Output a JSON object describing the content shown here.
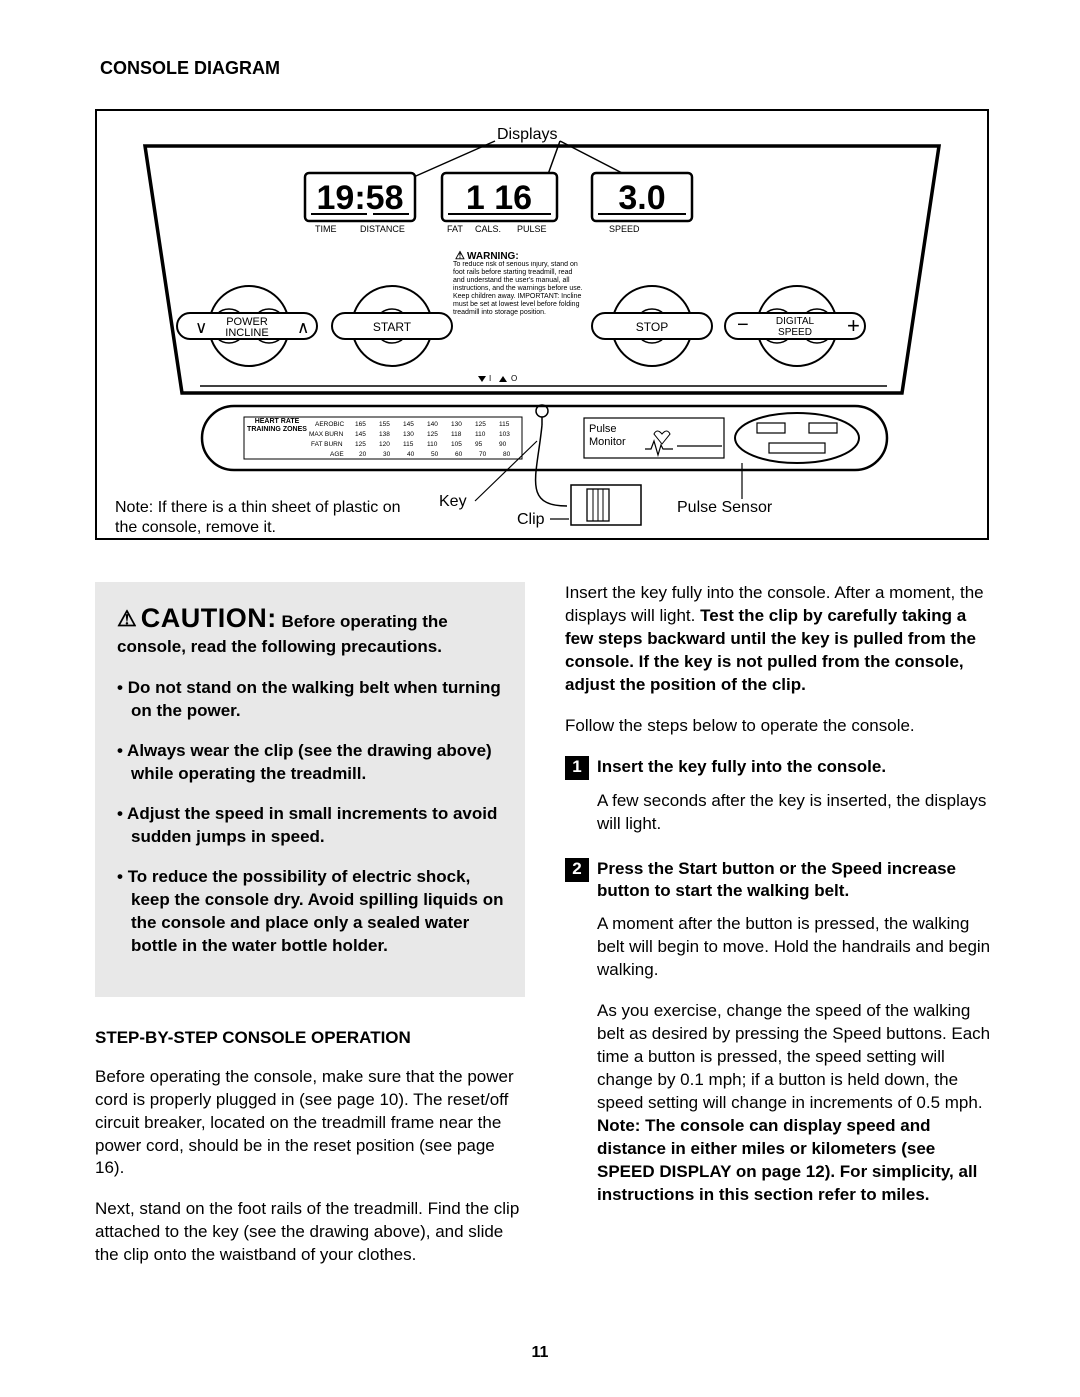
{
  "title": "CONSOLE DIAGRAM",
  "page_number": "11",
  "diagram": {
    "labels": {
      "displays": "Displays",
      "time": "TIME",
      "distance": "DISTANCE",
      "fat": "FAT",
      "cals": "CALS.",
      "pulse": "PULSE",
      "speed_small": "SPEED",
      "warning_head": "WARNING:",
      "warning_text": "To reduce risk of serious injury, stand on foot rails before starting treadmill, read and understand the user's manual, all instructions, and the warnings before use. Keep children away. IMPORTANT: Incline must be set at lowest level before folding treadmill into storage position.",
      "power": "POWER",
      "incline": "INCLINE",
      "start": "START",
      "stop": "STOP",
      "digital": "DIGITAL",
      "speed": "SPEED",
      "note": "Note: If there is a thin sheet of plastic on the console, remove it.",
      "key": "Key",
      "pulse_monitor": "Pulse\nMonitor",
      "clip": "Clip",
      "pulse_sensor": "Pulse Sensor",
      "hrtz_title": "HEART RATE\nTRAINING ZONES",
      "hr_rows": [
        "AEROBIC",
        "MAX BURN",
        "FAT BURN",
        "AGE"
      ],
      "hr_grid": [
        [
          "165",
          "155",
          "145",
          "140",
          "130",
          "125",
          "115"
        ],
        [
          "145",
          "138",
          "130",
          "125",
          "118",
          "110",
          "103"
        ],
        [
          "125",
          "120",
          "115",
          "110",
          "105",
          "95",
          "90"
        ],
        [
          "20",
          "30",
          "40",
          "50",
          "60",
          "70",
          "80"
        ]
      ],
      "disp1": "19:58",
      "disp2": "1 16",
      "disp3": "3.0"
    }
  },
  "caution": {
    "head_big": "CAUTION:",
    "head_tail": "Before operating the console, read the following precautions.",
    "items": [
      "Do not stand on the walking belt when turning on the power.",
      "Always wear the clip (see the drawing above) while operating the treadmill.",
      "Adjust the speed in small increments to avoid sudden jumps in speed.",
      "To reduce the possibility of electric shock, keep the console dry. Avoid spilling liquids on the console and place only a sealed water bottle in the water bottle holder."
    ]
  },
  "step_section_head": "STEP-BY-STEP CONSOLE OPERATION",
  "left_paras": [
    "Before operating the console, make sure that the power cord is properly plugged in (see page 10). The reset/off circuit breaker, located on the treadmill frame near the power cord, should be in the reset position (see page 16).",
    "Next, stand on the foot rails of the treadmill. Find the clip attached to the key (see the drawing above), and slide the clip onto the waistband of your clothes."
  ],
  "right_intro": {
    "pre": "Insert the key fully into the console. After a moment, the displays will light. ",
    "bold": "Test the clip by carefully taking a few steps backward until the key is pulled from the console. If the key is not pulled from the console, adjust the position of the clip.",
    "follow": "Follow the steps below to operate the console."
  },
  "steps": [
    {
      "num": "1",
      "head": "Insert the key fully into the console.",
      "body": [
        "A few seconds after the key is inserted, the displays will light."
      ]
    },
    {
      "num": "2",
      "head": "Press the Start button or the Speed increase button to start the walking belt.",
      "body1": "A moment after the button is pressed, the walking belt will begin to move. Hold the handrails and begin walking.",
      "body2_pre": "As you exercise, change the speed of the walking belt as desired by pressing the Speed buttons. Each time a button is pressed, the speed setting will change by 0.1 mph; if a button is held down, the speed setting will change in increments of 0.5 mph. ",
      "body2_bold": "Note: The console can display speed and distance in either miles or kilometers (see SPEED DISPLAY on page 12). For simplicity, all instructions in this section refer to miles."
    }
  ]
}
